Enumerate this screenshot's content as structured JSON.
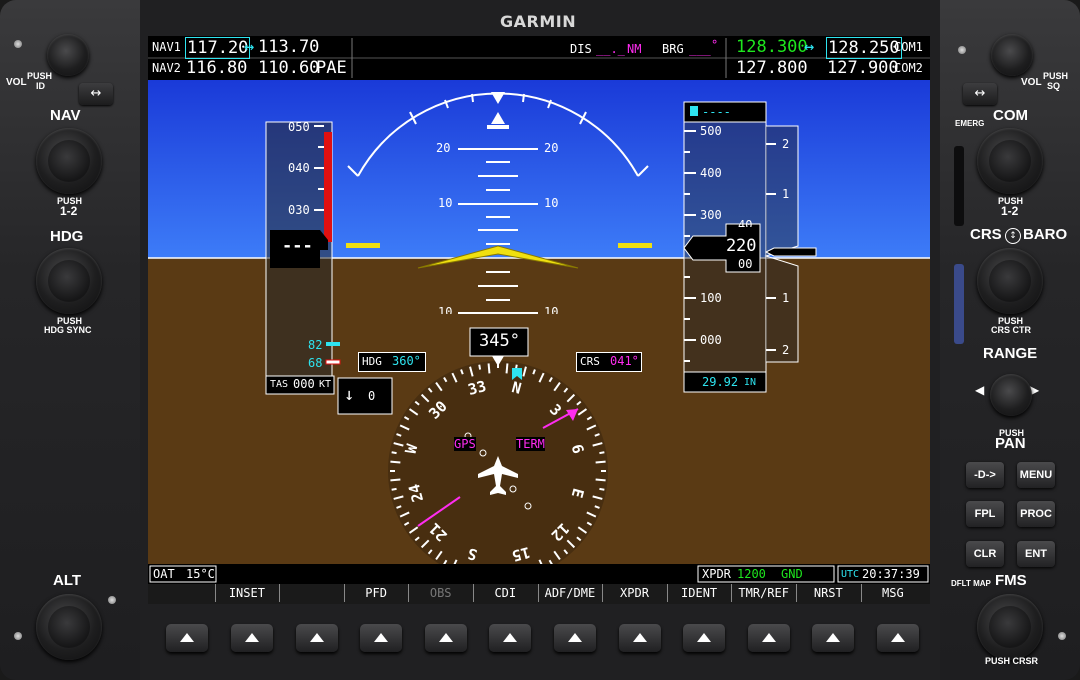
{
  "device": {
    "brand": "GARMIN"
  },
  "left_panel": {
    "vol_label": "VOL",
    "vol_push": "PUSH",
    "vol_push_sub": "ID",
    "swap_icon": "double-arrow-icon",
    "nav_label": "NAV",
    "nav_push": "PUSH",
    "nav_push_sub": "1-2",
    "hdg_label": "HDG",
    "hdg_push": "PUSH",
    "hdg_push_sub": "HDG SYNC",
    "alt_label": "ALT"
  },
  "right_panel": {
    "vol_label": "VOL",
    "vol_push": "PUSH",
    "vol_push_sub": "SQ",
    "emerg_label": "EMERG",
    "com_label": "COM",
    "com_push": "PUSH",
    "com_push_sub": "1-2",
    "crs_label": "CRS",
    "baro_label": "BARO",
    "crs_push": "PUSH",
    "crs_push_sub": "CRS CTR",
    "range_label": "RANGE",
    "range_push": "PUSH",
    "pan_label": "PAN",
    "buttons": {
      "direct": "-D->",
      "menu": "MENU",
      "fpl": "FPL",
      "proc": "PROC",
      "clr": "CLR",
      "ent": "ENT"
    },
    "dflt_map": "DFLT MAP",
    "fms_label": "FMS",
    "fms_push": "PUSH CRSR"
  },
  "top_bar": {
    "nav1_label": "NAV1",
    "nav1_active": "117.20",
    "nav1_standby": "113.70",
    "nav2_label": "NAV2",
    "nav2_active": "116.80",
    "nav2_standby": "110.60",
    "nav2_ident": "PAE",
    "dis_label": "DIS",
    "dis_value": "__._",
    "dis_unit": "NM",
    "brg_label": "BRG",
    "brg_value": "___",
    "brg_unit": "°",
    "com1_active": "128.300",
    "com1_standby": "128.250",
    "com1_label": "COM1",
    "com2_active": "127.800",
    "com2_standby": "127.900",
    "com2_label": "COM2"
  },
  "airspeed": {
    "ticks": [
      "050",
      "040",
      "030"
    ],
    "current": "---",
    "tas_label": "TAS",
    "tas_value": "000",
    "tas_unit": "KT",
    "vspeed_82": "82",
    "vspeed_68": "68"
  },
  "attitude": {
    "pitch_labels": [
      "20",
      "20",
      "10",
      "10",
      "10",
      "10"
    ]
  },
  "altitude": {
    "selected": "----",
    "ticks": [
      "500",
      "400",
      "300",
      "100",
      "000"
    ],
    "current_hundreds": "2",
    "current_tens": "20",
    "roll_above": "40",
    "roll_below": "00",
    "baro_value": "29.92",
    "baro_unit": "IN",
    "vsi_ticks": [
      "2",
      "1",
      "1",
      "2"
    ]
  },
  "hsi": {
    "heading": "345°",
    "hdg_label": "HDG",
    "hdg_value": "360°",
    "crs_label": "CRS",
    "crs_value": "041°",
    "nav_source": "GPS",
    "flight_phase": "TERM",
    "compass": [
      "N",
      "3",
      "6",
      "E",
      "12",
      "15",
      "S",
      "21",
      "24",
      "W",
      "30",
      "33"
    ]
  },
  "vsi_box": {
    "arrow": "↓",
    "value": "0"
  },
  "bottom_bar": {
    "oat_label": "OAT",
    "oat_value": "15°C",
    "xpdr_label": "XPDR",
    "xpdr_code": "1200",
    "xpdr_mode": "GND",
    "utc_label": "UTC",
    "utc_time": "20:37:39"
  },
  "softkeys": [
    "",
    "INSET",
    "",
    "PFD",
    "OBS",
    "CDI",
    "ADF/DME",
    "XPDR",
    "IDENT",
    "TMR/REF",
    "NRST",
    "MSG"
  ],
  "colors": {
    "sky": "#1f4df0",
    "ground": "#5a3a14",
    "cyan": "#2ee4f0",
    "magenta": "#ff2cf0",
    "green": "#1ee61e"
  }
}
